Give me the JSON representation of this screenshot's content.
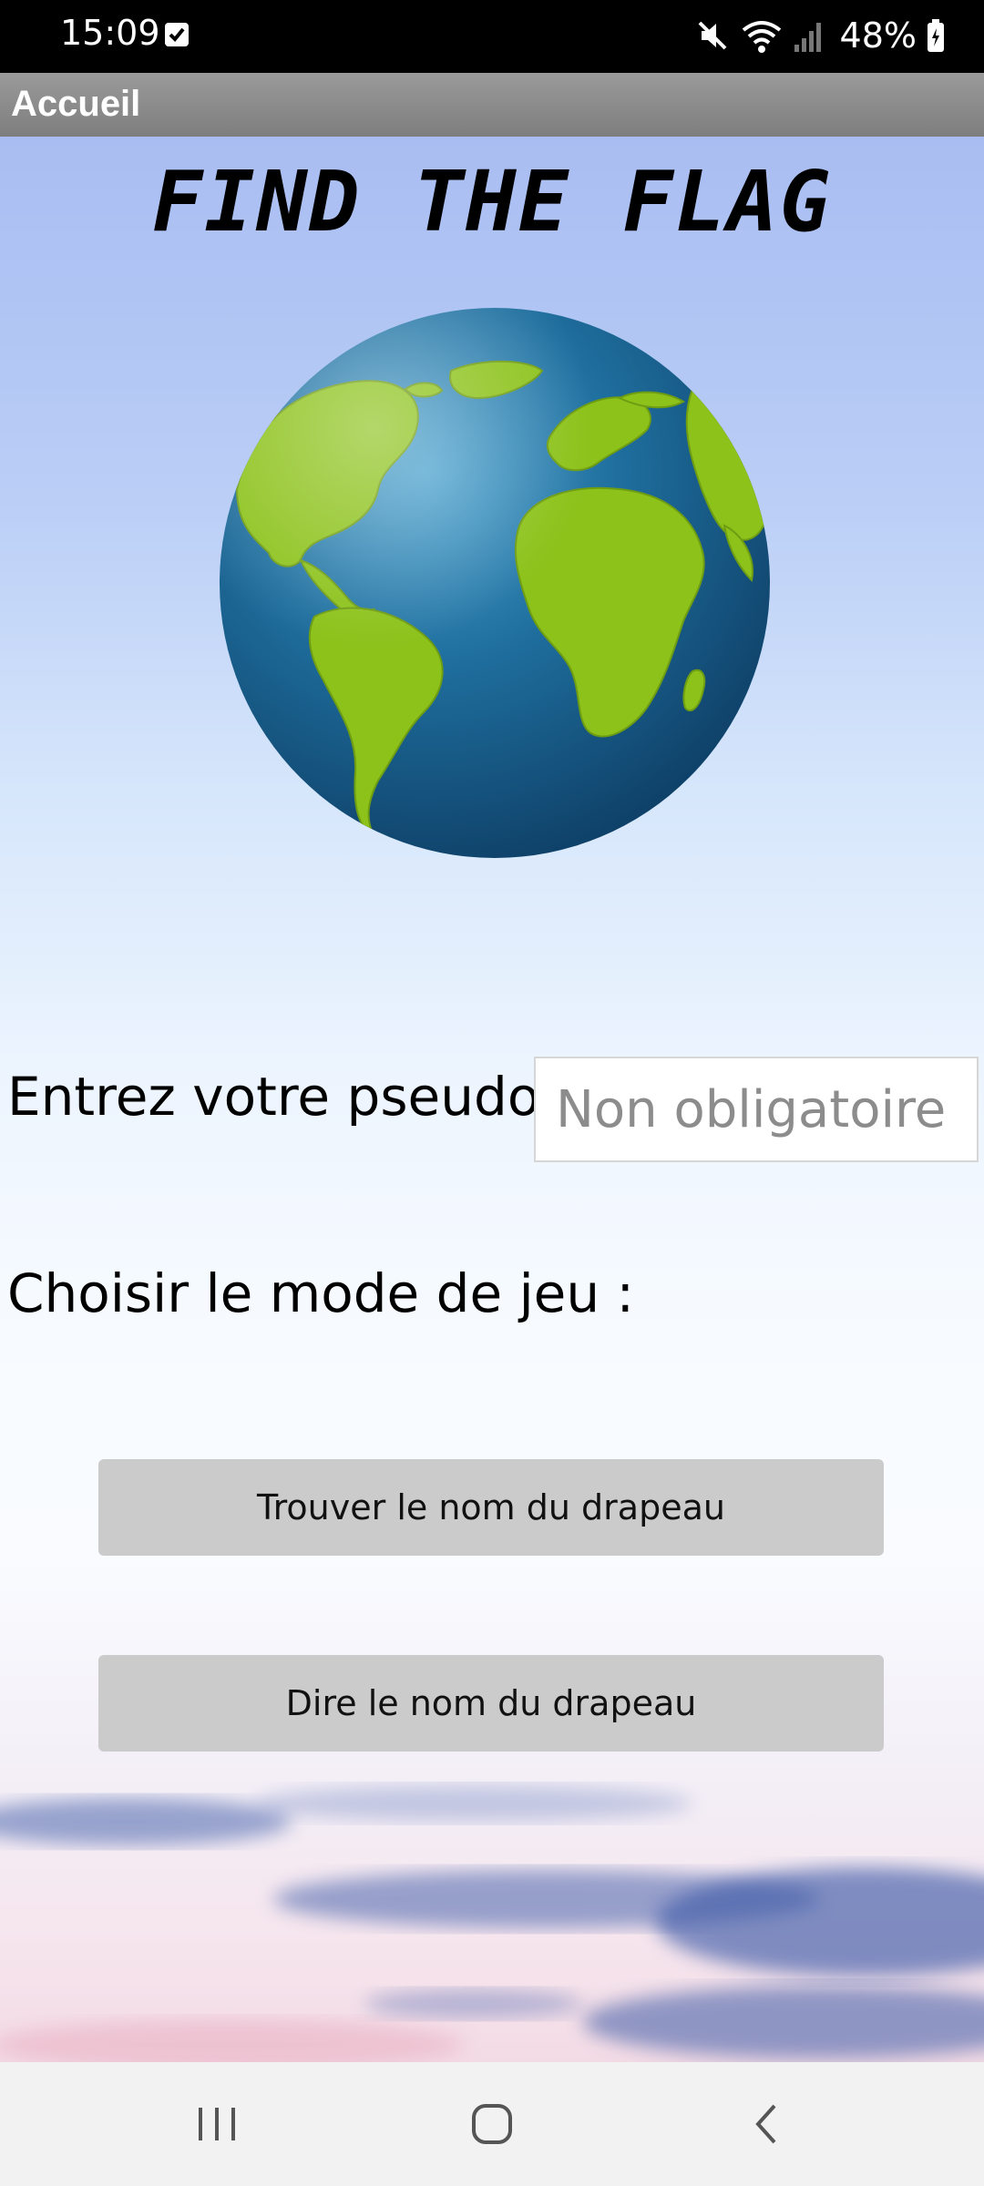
{
  "status_bar": {
    "time": "15:09",
    "battery_percent": "48%",
    "icons": [
      "checkbox-notification-icon",
      "mute-icon",
      "wifi-icon",
      "signal-icon",
      "battery-icon"
    ]
  },
  "app_bar": {
    "title": "Accueil"
  },
  "main": {
    "game_title": "FIND THE FLAG",
    "globe_icon": "earth-globe",
    "pseudo": {
      "label": "Entrez votre pseudo :",
      "placeholder": "Non obligatoire",
      "value": ""
    },
    "mode_label": "Choisir le mode de jeu :",
    "buttons": {
      "find_flag_name": "Trouver le nom du drapeau",
      "say_flag_name": "Dire le nom du drapeau"
    }
  },
  "nav_bar": {
    "items": [
      "recents-icon",
      "home-icon",
      "back-icon"
    ]
  },
  "colors": {
    "app_bar": "#8a8a8a",
    "button_bg": "#cbcbcb",
    "ocean": "#1f6a9a",
    "land": "#8cc21a"
  }
}
